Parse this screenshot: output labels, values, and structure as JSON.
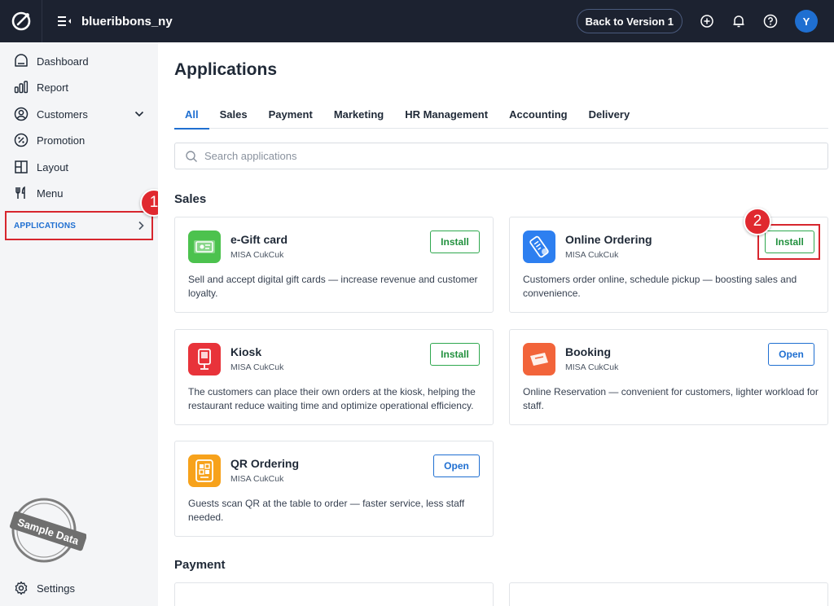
{
  "topbar": {
    "store_name": "blueribbons_ny",
    "back_label": "Back to Version 1",
    "avatar_initial": "Y"
  },
  "sidebar": {
    "items": [
      {
        "label": "Dashboard",
        "icon": "dashboard-icon"
      },
      {
        "label": "Report",
        "icon": "report-icon"
      },
      {
        "label": "Customers",
        "icon": "customers-icon"
      },
      {
        "label": "Promotion",
        "icon": "promotion-icon"
      },
      {
        "label": "Layout",
        "icon": "layout-icon"
      },
      {
        "label": "Menu",
        "icon": "menu-icon"
      }
    ],
    "applications_label": "APPLICATIONS",
    "stamp_text": "Sample Data",
    "settings_label": "Settings"
  },
  "annotations": {
    "marker_1": "1",
    "marker_2": "2",
    "color": "#e0282f"
  },
  "main": {
    "title": "Applications",
    "tabs": [
      "All",
      "Sales",
      "Payment",
      "Marketing",
      "HR Management",
      "Accounting",
      "Delivery"
    ],
    "search_placeholder": "Search applications",
    "sections": {
      "sales": "Sales",
      "payment": "Payment"
    },
    "cards": [
      {
        "name": "e-Gift card",
        "vendor": "MISA CukCuk",
        "button": "Install",
        "desc": "Sell and accept digital gift cards — increase revenue and customer loyalty.",
        "icon": "gift-card-icon",
        "color": "#4cc24e"
      },
      {
        "name": "Online Ordering",
        "vendor": "MISA CukCuk",
        "button": "Install",
        "desc": "Customers order online, schedule pickup — boosting sales and convenience.",
        "icon": "online-ordering-icon",
        "color": "#2d7ff0"
      },
      {
        "name": "Kiosk",
        "vendor": "MISA CukCuk",
        "button": "Install",
        "desc": "The customers can place their own orders at the kiosk, helping the restaurant reduce waiting time and optimize operational efficiency.",
        "icon": "kiosk-icon",
        "color": "#e8333a"
      },
      {
        "name": "Booking",
        "vendor": "MISA CukCuk",
        "button": "Open",
        "desc": "Online Reservation — convenient for customers, lighter workload for staff.",
        "icon": "booking-icon",
        "color": "#f2643a"
      },
      {
        "name": "QR Ordering",
        "vendor": "MISA CukCuk",
        "button": "Open",
        "desc": "Guests scan QR at the table to order — faster service, less staff needed.",
        "icon": "qr-ordering-icon",
        "color": "#f7a21b"
      }
    ]
  }
}
